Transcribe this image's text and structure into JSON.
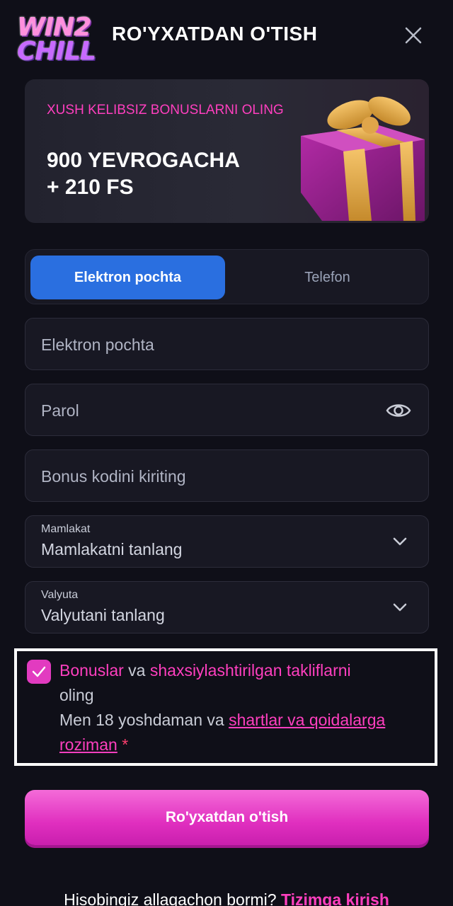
{
  "header": {
    "logo_line1": "WIN2",
    "logo_line2": "CHILL",
    "title": "RO'YXATDAN O'TISH",
    "close_icon": "close-icon"
  },
  "banner": {
    "subtitle": "XUSH KELIBSIZ BONUSLARNI OLING",
    "headline_line1": "900 YEVROGACHA",
    "headline_line2": "+ 210 FS",
    "image": "gift-box-icon"
  },
  "tabs": [
    {
      "label": "Elektron pochta",
      "active": true
    },
    {
      "label": "Telefon",
      "active": false
    }
  ],
  "form": {
    "email_placeholder": "Elektron pochta",
    "password_placeholder": "Parol",
    "password_toggle_icon": "eye-icon",
    "bonus_placeholder": "Bonus kodini kiriting",
    "country_label": "Mamlakat",
    "country_value": "Mamlakatni tanlang",
    "currency_label": "Valyuta",
    "currency_value": "Valyutani tanlang",
    "dropdown_icon": "chevron-down-icon"
  },
  "consent": {
    "checked": true,
    "bonus_link": "Bonuslar",
    "and1": " va ",
    "offers_link": "shaxsiylashtirilgan takliflarni",
    "get_text": " oling",
    "age_text": "Men 18 yoshdaman va ",
    "terms_link": "shartlar va qoidalarga roziman",
    "required_mark": " *"
  },
  "submit_label": "Ro'yxatdan o'tish",
  "footer": {
    "question": "Hisobingiz allaqachon bormi?",
    "login_link": "Tizimga kirish"
  },
  "colors": {
    "accent_pink": "#ff3fbf",
    "tab_active_blue": "#2a6fe0",
    "background": "#0f0f18"
  }
}
